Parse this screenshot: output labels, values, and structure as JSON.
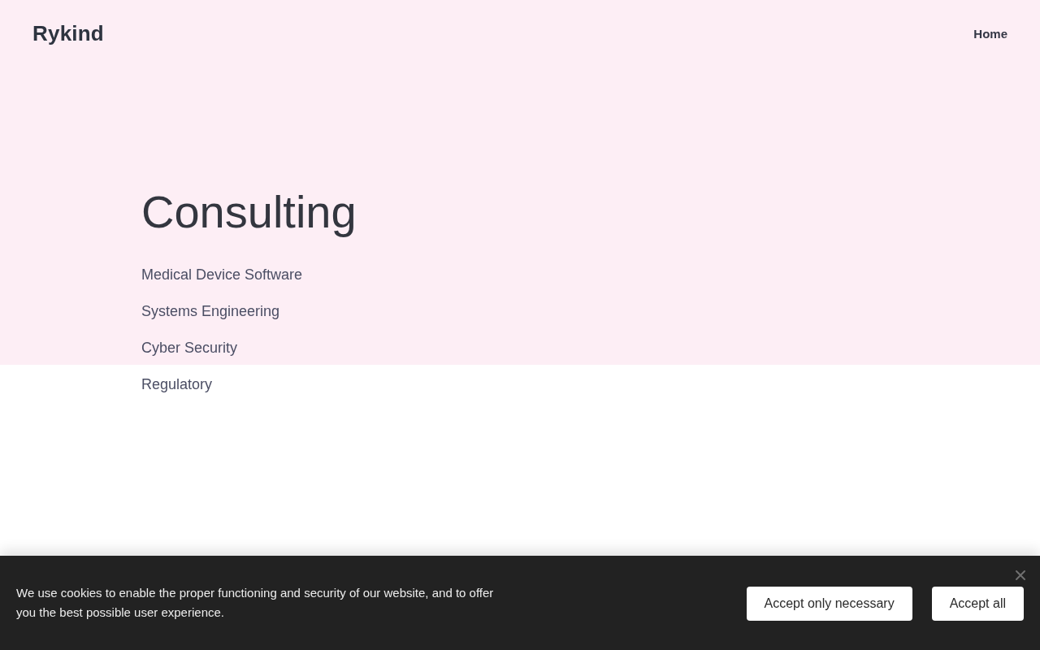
{
  "header": {
    "logo": "Rykind",
    "nav": [
      {
        "label": "Home"
      }
    ]
  },
  "hero": {
    "title": "Consulting",
    "services": [
      "Medical Device Software",
      "Systems Engineering",
      "Cyber Security",
      "Regulatory"
    ]
  },
  "cookie_banner": {
    "message": "We use cookies to enable the proper functioning and security of our website, and to offer you the best possible user experience.",
    "buttons": [
      "Accept only necessary",
      "Accept all"
    ]
  }
}
